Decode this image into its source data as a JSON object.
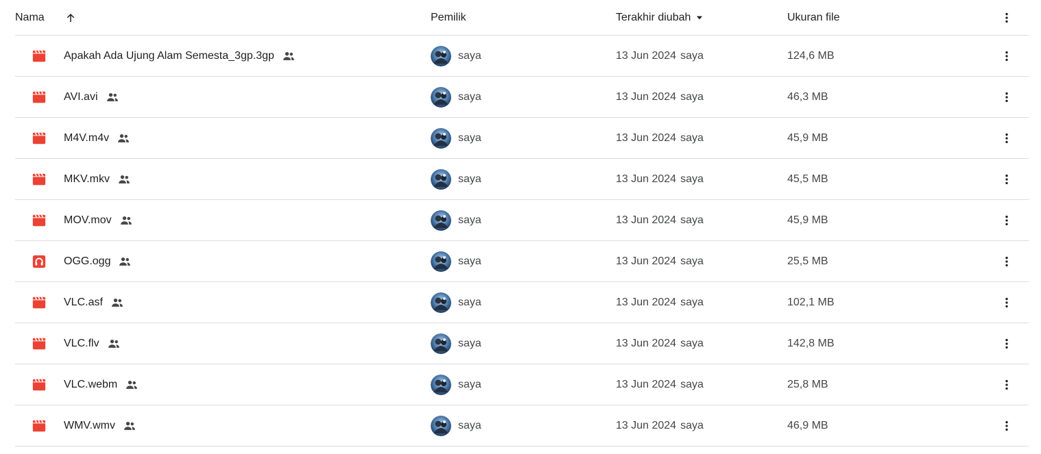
{
  "colors": {
    "video_icon": "#ea4335",
    "audio_icon": "#ea4335",
    "divider": "#dadce0",
    "text_primary": "#1f1f1f",
    "text_secondary": "#444746"
  },
  "header": {
    "name_label": "Nama",
    "sort_icon": "arrow-up-icon",
    "owner_label": "Pemilik",
    "modified_label": "Terakhir diubah",
    "modified_sort_icon": "caret-down-icon",
    "size_label": "Ukuran file",
    "more_icon": "more-vert-icon"
  },
  "files": [
    {
      "name": "Apakah Ada Ujung Alam Semesta_3gp.3gp",
      "icon": "video-icon",
      "shared": "shared-icon",
      "owner": "saya",
      "date": "13 Jun 2024",
      "modified_by": "saya",
      "size": "124,6 MB"
    },
    {
      "name": "AVI.avi",
      "icon": "video-icon",
      "shared": "shared-icon",
      "owner": "saya",
      "date": "13 Jun 2024",
      "modified_by": "saya",
      "size": "46,3 MB"
    },
    {
      "name": "M4V.m4v",
      "icon": "video-icon",
      "shared": "shared-icon",
      "owner": "saya",
      "date": "13 Jun 2024",
      "modified_by": "saya",
      "size": "45,9 MB"
    },
    {
      "name": "MKV.mkv",
      "icon": "video-icon",
      "shared": "shared-icon",
      "owner": "saya",
      "date": "13 Jun 2024",
      "modified_by": "saya",
      "size": "45,5 MB"
    },
    {
      "name": "MOV.mov",
      "icon": "video-icon",
      "shared": "shared-icon",
      "owner": "saya",
      "date": "13 Jun 2024",
      "modified_by": "saya",
      "size": "45,9 MB"
    },
    {
      "name": "OGG.ogg",
      "icon": "audio-icon",
      "shared": "shared-icon",
      "owner": "saya",
      "date": "13 Jun 2024",
      "modified_by": "saya",
      "size": "25,5 MB"
    },
    {
      "name": "VLC.asf",
      "icon": "video-icon",
      "shared": "shared-icon",
      "owner": "saya",
      "date": "13 Jun 2024",
      "modified_by": "saya",
      "size": "102,1 MB"
    },
    {
      "name": "VLC.flv",
      "icon": "video-icon",
      "shared": "shared-icon",
      "owner": "saya",
      "date": "13 Jun 2024",
      "modified_by": "saya",
      "size": "142,8 MB"
    },
    {
      "name": "VLC.webm",
      "icon": "video-icon",
      "shared": "shared-icon",
      "owner": "saya",
      "date": "13 Jun 2024",
      "modified_by": "saya",
      "size": "25,8 MB"
    },
    {
      "name": "WMV.wmv",
      "icon": "video-icon",
      "shared": "shared-icon",
      "owner": "saya",
      "date": "13 Jun 2024",
      "modified_by": "saya",
      "size": "46,9 MB"
    }
  ]
}
